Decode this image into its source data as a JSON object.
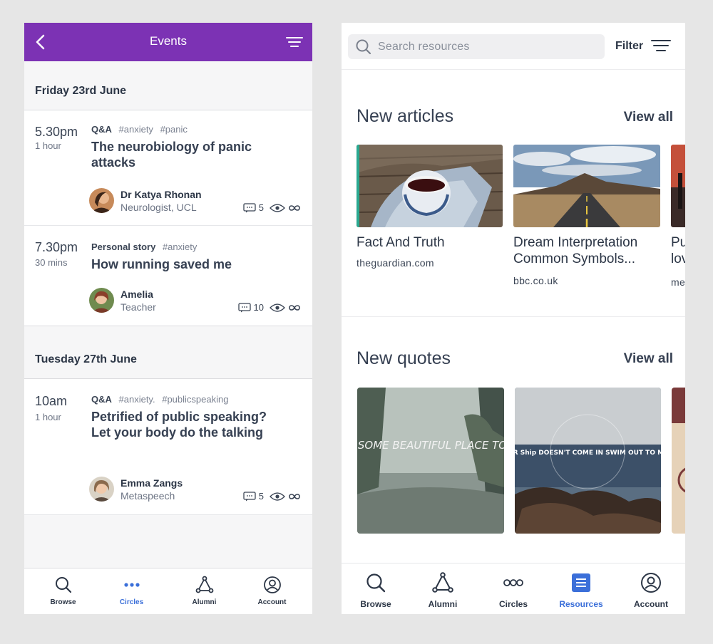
{
  "events_screen": {
    "header": {
      "title": "Events"
    },
    "days": [
      {
        "label": "Friday 23rd June",
        "events": [
          {
            "time": "5.30pm",
            "duration": "1 hour",
            "type": "Q&A",
            "tags": [
              "#anxiety",
              "#panic"
            ],
            "title": "The neurobiology of panic attacks",
            "speaker": {
              "name": "Dr Katya Rhonan",
              "role": "Neurologist, UCL"
            },
            "comments": "5"
          },
          {
            "time": "7.30pm",
            "duration": "30 mins",
            "type": "Personal story",
            "tags": [
              "#anxiety"
            ],
            "title": "How running saved me",
            "speaker": {
              "name": "Amelia",
              "role": "Teacher"
            },
            "comments": "10"
          }
        ]
      },
      {
        "label": "Tuesday 27th June",
        "events": [
          {
            "time": "10am",
            "duration": "1 hour",
            "type": "Q&A",
            "tags": [
              "#anxiety.",
              "#publicspeaking"
            ],
            "title": "Petrified of public speaking? Let your body do the talking",
            "speaker": {
              "name": "Emma Zangs",
              "role": "Metaspeech"
            },
            "comments": "5"
          }
        ]
      }
    ],
    "tabbar": [
      {
        "label": "Browse",
        "icon": "search-icon"
      },
      {
        "label": "Circles",
        "icon": "dots-icon",
        "active": true
      },
      {
        "label": "Alumni",
        "icon": "network-icon"
      },
      {
        "label": "Account",
        "icon": "user-icon"
      }
    ]
  },
  "resources_screen": {
    "search": {
      "placeholder": "Search resources"
    },
    "filter_label": "Filter",
    "articles": {
      "title": "New articles",
      "view_all": "View all",
      "items": [
        {
          "title": "Fact And Truth",
          "source": "theguardian.com"
        },
        {
          "title": "Dream Interpretation Common Symbols...",
          "source": "bbc.co.uk"
        },
        {
          "title": "Pu lov",
          "source": "me"
        }
      ]
    },
    "quotes": {
      "title": "New quotes",
      "view_all": "View all",
      "items": [
        {
          "text": "Let's FIND SOME BEAUTIFUL PLACE TO GET Lost."
        },
        {
          "text": "IF YOUR Ship DOESN'T COME IN SWIM OUT TO MEET IT"
        }
      ]
    },
    "tabbar": [
      {
        "label": "Browse",
        "icon": "search-icon"
      },
      {
        "label": "Alumni",
        "icon": "network-icon"
      },
      {
        "label": "Circles",
        "icon": "circles-icon"
      },
      {
        "label": "Resources",
        "icon": "resources-icon",
        "active": true
      },
      {
        "label": "Account",
        "icon": "user-icon"
      }
    ]
  },
  "colors": {
    "header_purple": "#7c32b4",
    "accent_blue": "#3b6fd9",
    "text_dark": "#2c3646"
  }
}
